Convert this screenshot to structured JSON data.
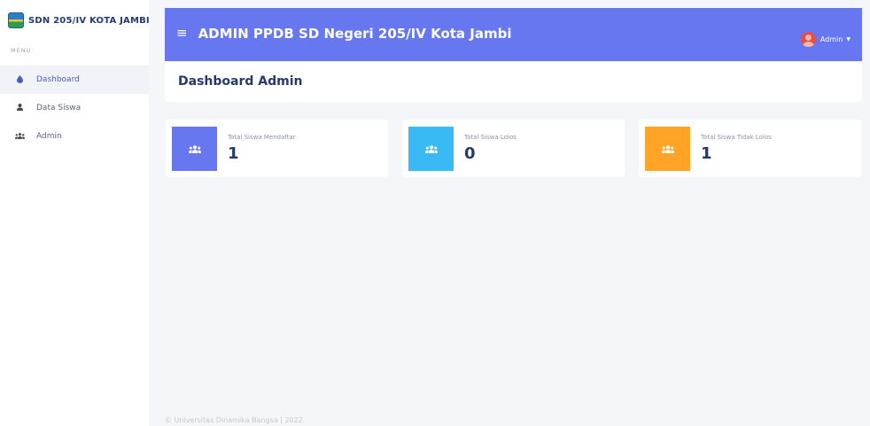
{
  "sidebar": {
    "brand": "SDN 205/IV KOTA JAMBI",
    "menu_title": "MENU",
    "items": [
      {
        "label": "Dashboard",
        "icon": "droplet-icon",
        "active": true
      },
      {
        "label": "Data Siswa",
        "icon": "user-icon",
        "active": false
      },
      {
        "label": "Admin",
        "icon": "users-icon",
        "active": false
      }
    ]
  },
  "header": {
    "title": "ADMIN PPDB SD Negeri 205/IV Kota Jambi",
    "user": "Admin",
    "accent_color": "#6777ef"
  },
  "page": {
    "title": "Dashboard Admin"
  },
  "stats": [
    {
      "label": "Total Siswa Mendaftar",
      "value": "1",
      "color": "#6777ef",
      "icon": "users-icon"
    },
    {
      "label": "Total Siswa Lolos",
      "value": "0",
      "color": "#3abaf4",
      "icon": "users-icon"
    },
    {
      "label": "Total Siswa Tidak Lolos",
      "value": "1",
      "color": "#ffa426",
      "icon": "users-icon"
    }
  ],
  "footer": {
    "text": "© Universitas Dinamika Bangsa | 2022"
  }
}
